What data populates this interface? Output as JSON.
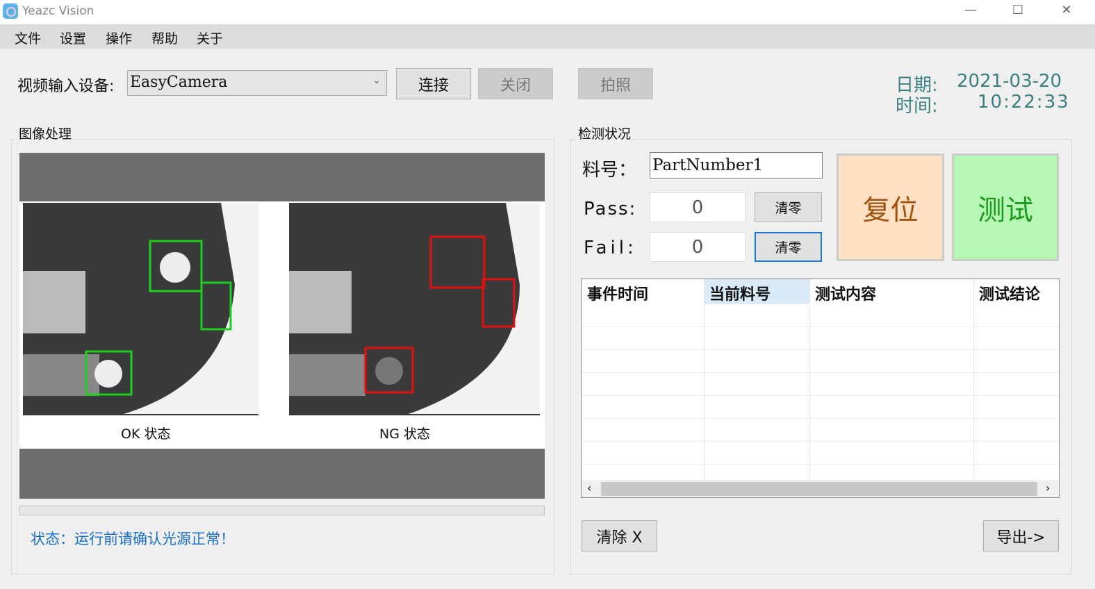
{
  "window": {
    "title": "Yeazc Vision",
    "minimize": "—",
    "maximize": "☐",
    "close": "✕"
  },
  "menu": [
    "文件",
    "设置",
    "操作",
    "帮助",
    "关于"
  ],
  "toolbar": {
    "device_label": "视频输入设备:",
    "device_value": "EasyCamera",
    "connect": "连接",
    "close": "关闭",
    "capture": "拍照"
  },
  "datetime": {
    "date_label": "日期:",
    "date": "2021-03-20",
    "time_label": "时间:",
    "time": "10:22:33",
    "color": "#3a8080"
  },
  "image_panel": {
    "title": "图像处理",
    "ok_label": "OK 状态",
    "ng_label": "NG 状态",
    "progress": 0,
    "status": "状态：运行前请确认光源正常！",
    "status_color": "#1a6fc4"
  },
  "detect": {
    "title": "检测状况",
    "part_label": "料号：",
    "part_value": "PartNumber1",
    "pass_label": "Pass:",
    "pass_value": "0",
    "fail_label": "Fail:",
    "fail_value": "0",
    "clear": "清零",
    "reset": "复位",
    "test": "测试"
  },
  "table": {
    "columns": [
      "事件时间",
      "当前料号",
      "测试内容",
      "测试结论"
    ],
    "rows": []
  },
  "footer": {
    "clear": "清除 X",
    "export": "导出->"
  }
}
